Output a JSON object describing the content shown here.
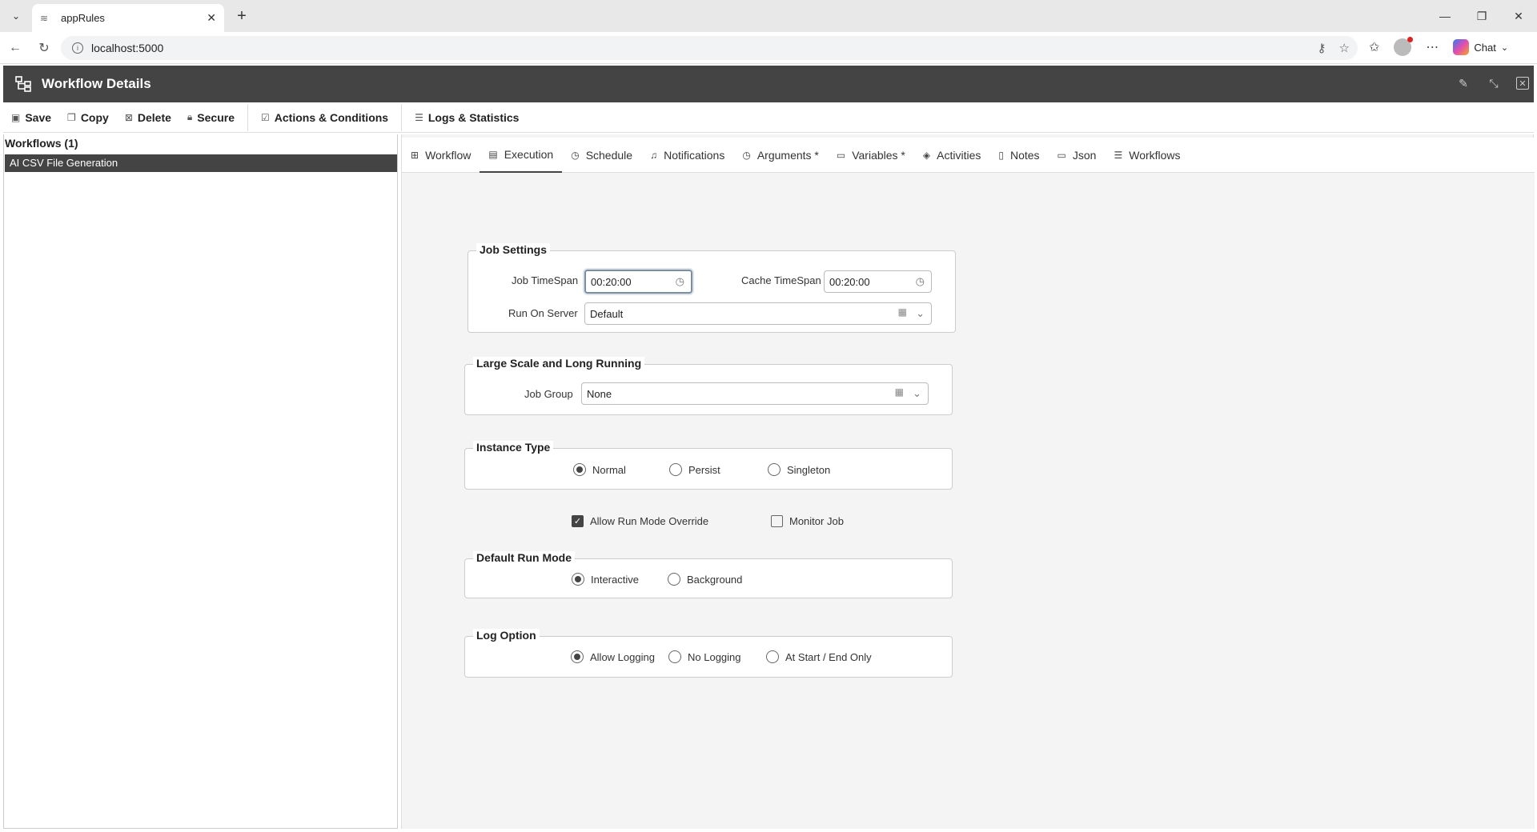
{
  "browser": {
    "tab_title": "appRules",
    "url": "localhost:5000",
    "chat_label": "Chat"
  },
  "header": {
    "title": "Workflow Details"
  },
  "toolbar": {
    "save": "Save",
    "copy": "Copy",
    "delete": "Delete",
    "secure": "Secure",
    "actions": "Actions & Conditions",
    "logs": "Logs & Statistics"
  },
  "left": {
    "title": "Workflows (1)",
    "items": [
      "AI CSV File Generation"
    ]
  },
  "tabs": [
    "Workflow",
    "Execution",
    "Schedule",
    "Notifications",
    "Arguments *",
    "Variables *",
    "Activities",
    "Notes",
    "Json",
    "Workflows"
  ],
  "active_tab": "Execution",
  "job_settings": {
    "legend": "Job Settings",
    "job_timespan_label": "Job TimeSpan",
    "job_timespan_value": "00:20:00",
    "cache_timespan_label": "Cache TimeSpan",
    "cache_timespan_value": "00:20:00",
    "run_on_server_label": "Run On Server",
    "run_on_server_value": "Default"
  },
  "large_scale": {
    "legend": "Large Scale and Long Running",
    "job_group_label": "Job Group",
    "job_group_value": "None"
  },
  "instance_type": {
    "legend": "Instance Type",
    "options": [
      "Normal",
      "Persist",
      "Singleton"
    ],
    "selected": "Normal"
  },
  "flags": {
    "allow_override": "Allow Run Mode Override",
    "allow_override_checked": true,
    "monitor_job": "Monitor Job",
    "monitor_job_checked": false
  },
  "run_mode": {
    "legend": "Default Run Mode",
    "options": [
      "Interactive",
      "Background"
    ],
    "selected": "Interactive"
  },
  "log_option": {
    "legend": "Log Option",
    "options": [
      "Allow Logging",
      "No Logging",
      "At Start / End Only"
    ],
    "selected": "Allow Logging"
  }
}
